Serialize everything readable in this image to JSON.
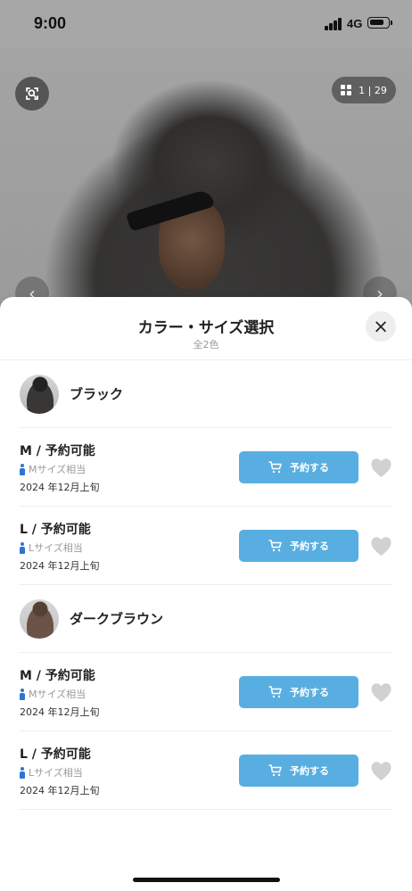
{
  "status_bar": {
    "time": "9:00",
    "network": "4G"
  },
  "product_viewer": {
    "page_counter": "1 | 29",
    "zoom_icon": "zoom-search-icon",
    "gallery_icon": "grid-icon"
  },
  "sheet": {
    "title": "カラー・サイズ選択",
    "subtitle": "全2色",
    "close_icon": "close-icon"
  },
  "colors": [
    {
      "name": "ブラック",
      "sizes": [
        {
          "label": "M / 予約可能",
          "equivalent": "Mサイズ相当",
          "date": "2024 年12月上旬",
          "button": "予約する"
        },
        {
          "label": "L / 予約可能",
          "equivalent": "Lサイズ相当",
          "date": "2024 年12月上旬",
          "button": "予約する"
        }
      ]
    },
    {
      "name": "ダークブラウン",
      "sizes": [
        {
          "label": "M / 予約可能",
          "equivalent": "Mサイズ相当",
          "date": "2024 年12月上旬",
          "button": "予約する"
        },
        {
          "label": "L / 予約可能",
          "equivalent": "Lサイズ相当",
          "date": "2024 年12月上旬",
          "button": "予約する"
        }
      ]
    }
  ],
  "colors_palette": {
    "button": "#58aee0",
    "divider": "#eeeeee",
    "muted_text": "#9a9a9a",
    "person_icon": "#2f74d0",
    "heart": "#d1d1d1"
  }
}
